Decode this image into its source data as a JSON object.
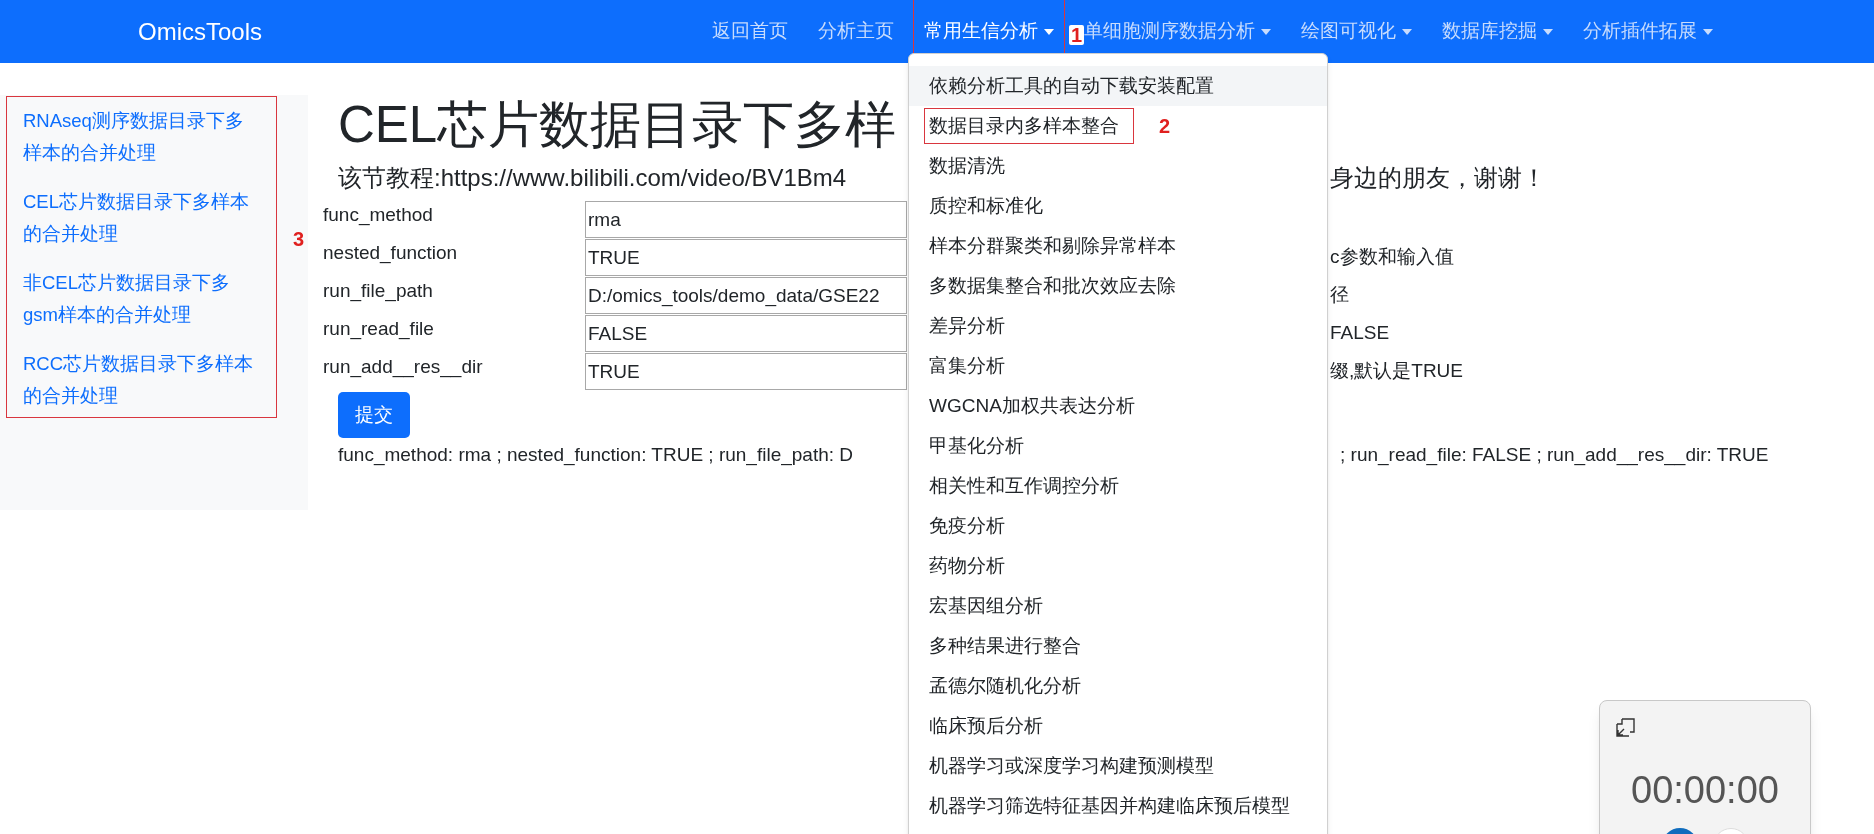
{
  "navbar": {
    "brand": "OmicsTools",
    "items": [
      {
        "label": "返回首页",
        "has_menu": false,
        "selected": false
      },
      {
        "label": "分析主页",
        "has_menu": false,
        "selected": false
      },
      {
        "label": "常用生信分析",
        "has_menu": true,
        "selected": true,
        "annotation": "1"
      },
      {
        "label": "单细胞测序数据分析",
        "has_menu": true,
        "selected": false
      },
      {
        "label": "绘图可视化",
        "has_menu": true,
        "selected": false
      },
      {
        "label": "数据库挖掘",
        "has_menu": true,
        "selected": false
      },
      {
        "label": "分析插件拓展",
        "has_menu": true,
        "selected": false
      }
    ]
  },
  "dropdown": {
    "items": [
      {
        "label": "依赖分析工具的自动下载安装配置",
        "highlighted": true
      },
      {
        "label": "数据目录内多样本整合",
        "highlighted": false,
        "annotation": "2"
      },
      {
        "label": "数据清洗",
        "highlighted": false
      },
      {
        "label": "质控和标准化",
        "highlighted": false
      },
      {
        "label": "样本分群聚类和剔除异常样本",
        "highlighted": false
      },
      {
        "label": "多数据集整合和批次效应去除",
        "highlighted": false
      },
      {
        "label": "差异分析",
        "highlighted": false
      },
      {
        "label": "富集分析",
        "highlighted": false
      },
      {
        "label": "WGCNA加权共表达分析",
        "highlighted": false
      },
      {
        "label": "甲基化分析",
        "highlighted": false
      },
      {
        "label": "相关性和互作调控分析",
        "highlighted": false
      },
      {
        "label": "免疫分析",
        "highlighted": false
      },
      {
        "label": "药物分析",
        "highlighted": false
      },
      {
        "label": "宏基因组分析",
        "highlighted": false
      },
      {
        "label": "多种结果进行整合",
        "highlighted": false
      },
      {
        "label": "孟德尔随机化分析",
        "highlighted": false
      },
      {
        "label": "临床预后分析",
        "highlighted": false
      },
      {
        "label": "机器学习或深度学习构建预测模型",
        "highlighted": false
      },
      {
        "label": "机器学习筛选特征基因并构建临床预后模型",
        "highlighted": false
      }
    ]
  },
  "sidebar": {
    "annotation": "3",
    "links": [
      "RNAseq测序数据目录下多样本的合并处理",
      "CEL芯片数据目录下多样本的合并处理",
      "非CEL芯片数据目录下多gsm样本的合并处理",
      "RCC芯片数据目录下多样本的合并处理"
    ]
  },
  "main": {
    "title": "CEL芯片数据目录下多样",
    "subtitle": "该节教程:https://www.bilibili.com/video/BV1Bm4",
    "subtitle_right": "身边的朋友，谢谢！",
    "form_rows": [
      {
        "label": "func_method",
        "value": "rma"
      },
      {
        "label": "nested_function",
        "value": "TRUE",
        "note": "c参数和输入值"
      },
      {
        "label": "run_file_path",
        "value": "D:/omics_tools/demo_data/GSE22",
        "note": "径"
      },
      {
        "label": "run_read_file",
        "value": "FALSE",
        "note": "FALSE"
      },
      {
        "label": "run_add__res__dir",
        "value": "TRUE",
        "note": "缀,默认是TRUE"
      }
    ],
    "submit": "提交",
    "result": "func_method: rma ; nested_function: TRUE ; run_file_path: D",
    "result_right": "; run_read_file: FALSE ; run_add__res__dir: TRUE"
  },
  "timer": {
    "time": "00:00:00"
  }
}
